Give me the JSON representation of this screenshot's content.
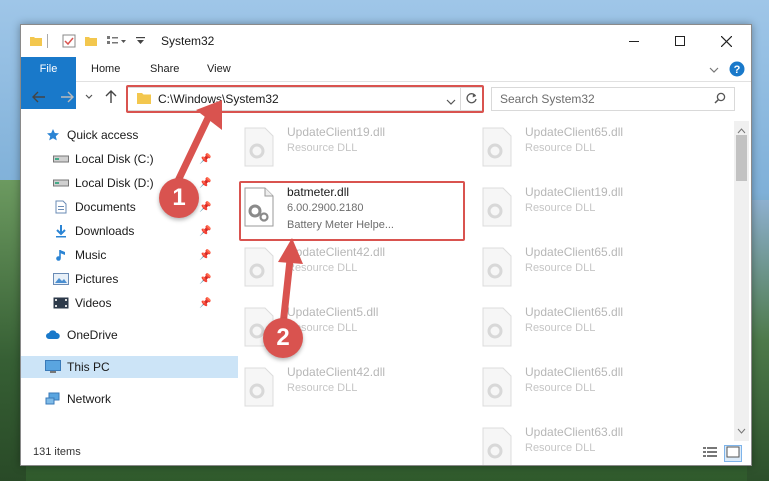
{
  "window": {
    "title": "System32"
  },
  "ribbon": {
    "tabs": [
      "File",
      "Home",
      "Share",
      "View"
    ]
  },
  "address": {
    "path": "C:\\Windows\\System32"
  },
  "search": {
    "placeholder": "Search System32"
  },
  "sidebar": {
    "items": [
      {
        "label": "Quick access",
        "icon": "star-icon",
        "pinned": false
      },
      {
        "label": "Local Disk (C:)",
        "icon": "drive-icon",
        "pinned": true
      },
      {
        "label": "Local Disk (D:)",
        "icon": "drive-icon",
        "pinned": true
      },
      {
        "label": "Documents",
        "icon": "documents-icon",
        "pinned": true
      },
      {
        "label": "Downloads",
        "icon": "download-icon",
        "pinned": true
      },
      {
        "label": "Music",
        "icon": "music-icon",
        "pinned": true
      },
      {
        "label": "Pictures",
        "icon": "pictures-icon",
        "pinned": true
      },
      {
        "label": "Videos",
        "icon": "videos-icon",
        "pinned": true
      },
      {
        "label": "OneDrive",
        "icon": "cloud-icon",
        "pinned": false
      },
      {
        "label": "This PC",
        "icon": "computer-icon",
        "pinned": false,
        "selected": true
      },
      {
        "label": "Network",
        "icon": "network-icon",
        "pinned": false
      }
    ]
  },
  "files": {
    "highlighted": {
      "name": "batmeter.dll",
      "version": "6.00.2900.2180",
      "description": "Battery Meter Helpe..."
    },
    "left": [
      {
        "name": "UpdateClient19.dll",
        "type": "Resource DLL"
      },
      {
        "name": "UpdateClient42.dll",
        "type": "Resource DLL"
      },
      {
        "name": "UpdateClient5.dll",
        "type": "Resource DLL"
      },
      {
        "name": "UpdateClient42.dll",
        "type": "Resource DLL"
      }
    ],
    "right": [
      {
        "name": "UpdateClient65.dll",
        "type": "Resource DLL"
      },
      {
        "name": "UpdateClient19.dll",
        "type": "Resource DLL"
      },
      {
        "name": "UpdateClient65.dll",
        "type": "Resource DLL"
      },
      {
        "name": "UpdateClient65.dll",
        "type": "Resource DLL"
      },
      {
        "name": "UpdateClient65.dll",
        "type": "Resource DLL"
      },
      {
        "name": "UpdateClient63.dll",
        "type": "Resource DLL"
      }
    ]
  },
  "status": {
    "count": "131 items"
  },
  "callouts": [
    "1",
    "2"
  ],
  "colors": {
    "accent": "#1979ca",
    "highlight": "#d9534f"
  }
}
